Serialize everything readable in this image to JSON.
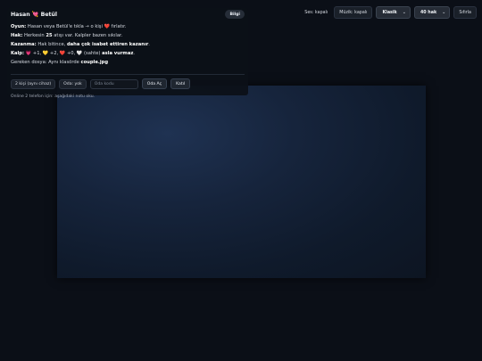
{
  "panel": {
    "title": "Hasan 💘 Betül",
    "info_button": "Bilgi",
    "rules": [
      {
        "label": "Oyun:",
        "parts": [
          {
            "t": " Hasan veya Betül'e tıkla → o kişi ❤️ fırlatır."
          }
        ]
      },
      {
        "label": "Hak:",
        "parts": [
          {
            "t": " Herkesin "
          },
          {
            "b": "25"
          },
          {
            "t": " atışı var. Kalpler bazen sıkılar."
          }
        ]
      },
      {
        "label": "Kazanma:",
        "parts": [
          {
            "t": " Hak bitince, "
          },
          {
            "b": "daha çok isabet ettiren kazanır"
          },
          {
            "t": "."
          }
        ]
      },
      {
        "label": "Kalp:",
        "parts": [
          {
            "t": " 💗 +1, 💛 +2, ❤️ +0, 🤍 (sahte) "
          },
          {
            "b": "asla vurmaz"
          },
          {
            "t": "."
          }
        ]
      },
      {
        "label": "",
        "parts": [
          {
            "t": "Gereken dosya: Aynı klasörde "
          },
          {
            "b": "couple.jpg"
          }
        ]
      }
    ],
    "controls": {
      "mode_chip": "2 kişi (aynı cihaz)",
      "room_chip": "Oda: yok",
      "room_code_placeholder": "Oda kodu",
      "create_room": "Oda Aç",
      "join_room": "Katıl"
    },
    "note": "Online 2 telefon için: aşağıdaki notu oku."
  },
  "topbar": {
    "sound": "Ses: kapalı",
    "music": "Müzik: kapalı",
    "mode_select": "Klasik",
    "shots_select": "40 hak",
    "reset": "Sıfırla"
  }
}
